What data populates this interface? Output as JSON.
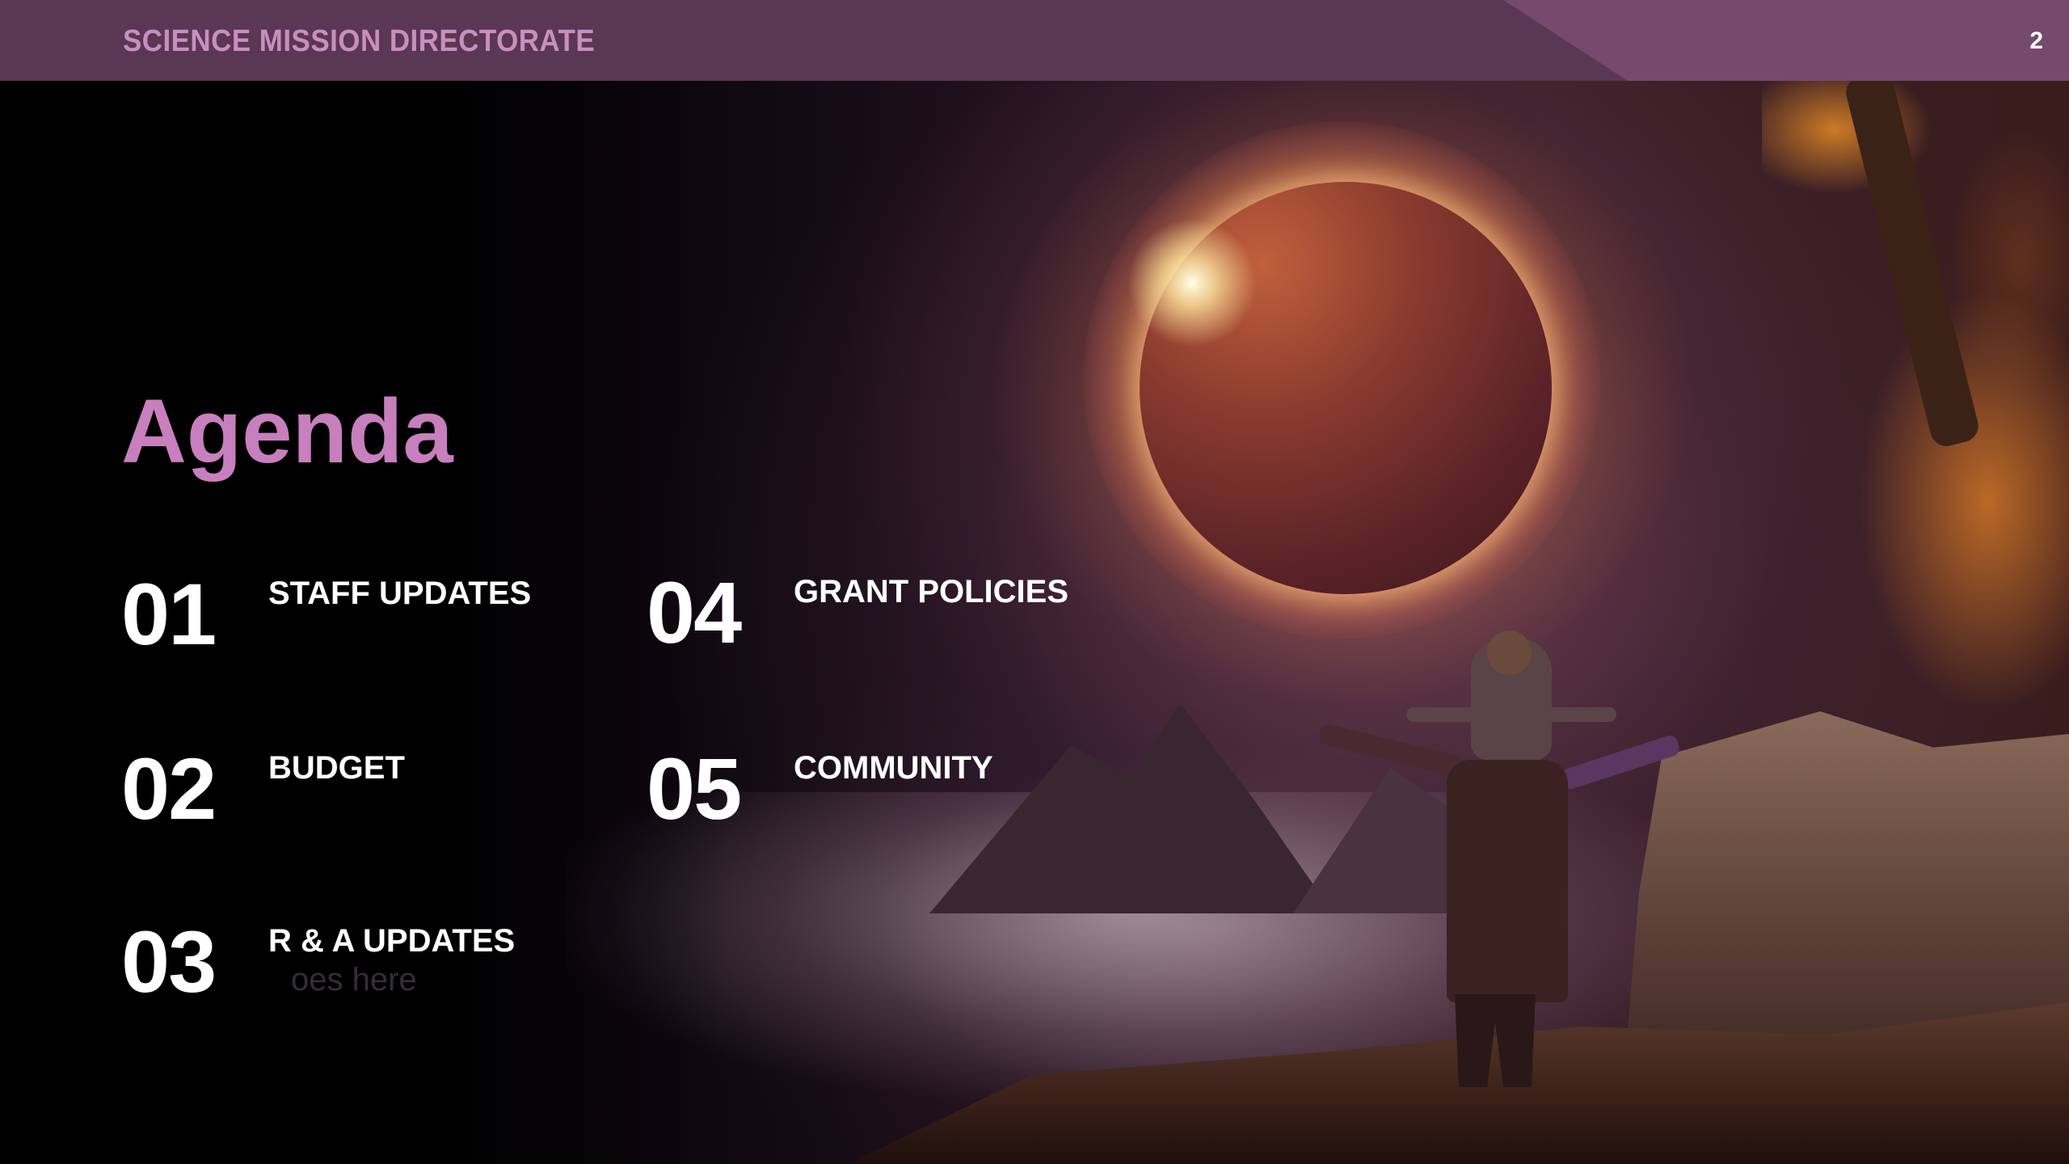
{
  "header": {
    "title": "SCIENCE MISSION DIRECTORATE",
    "page_number": "2"
  },
  "agenda": {
    "title": "Agenda",
    "items": [
      {
        "number": "01",
        "label": "STAFF UPDATES"
      },
      {
        "number": "02",
        "label": "BUDGET"
      },
      {
        "number": "03",
        "label": "R & A UPDATES"
      },
      {
        "number": "04",
        "label": "GRANT POLICIES"
      },
      {
        "number": "05",
        "label": "COMMUNITY"
      }
    ],
    "background_placeholder_text": "oes here"
  },
  "colors": {
    "header_bar": "#5a3752",
    "header_accent": "#754a6c",
    "header_text": "#c98ec0",
    "agenda_title": "#c77fbd",
    "item_text": "#ffffff"
  },
  "background_image": {
    "icon": "solar-eclipse-landscape-image"
  }
}
